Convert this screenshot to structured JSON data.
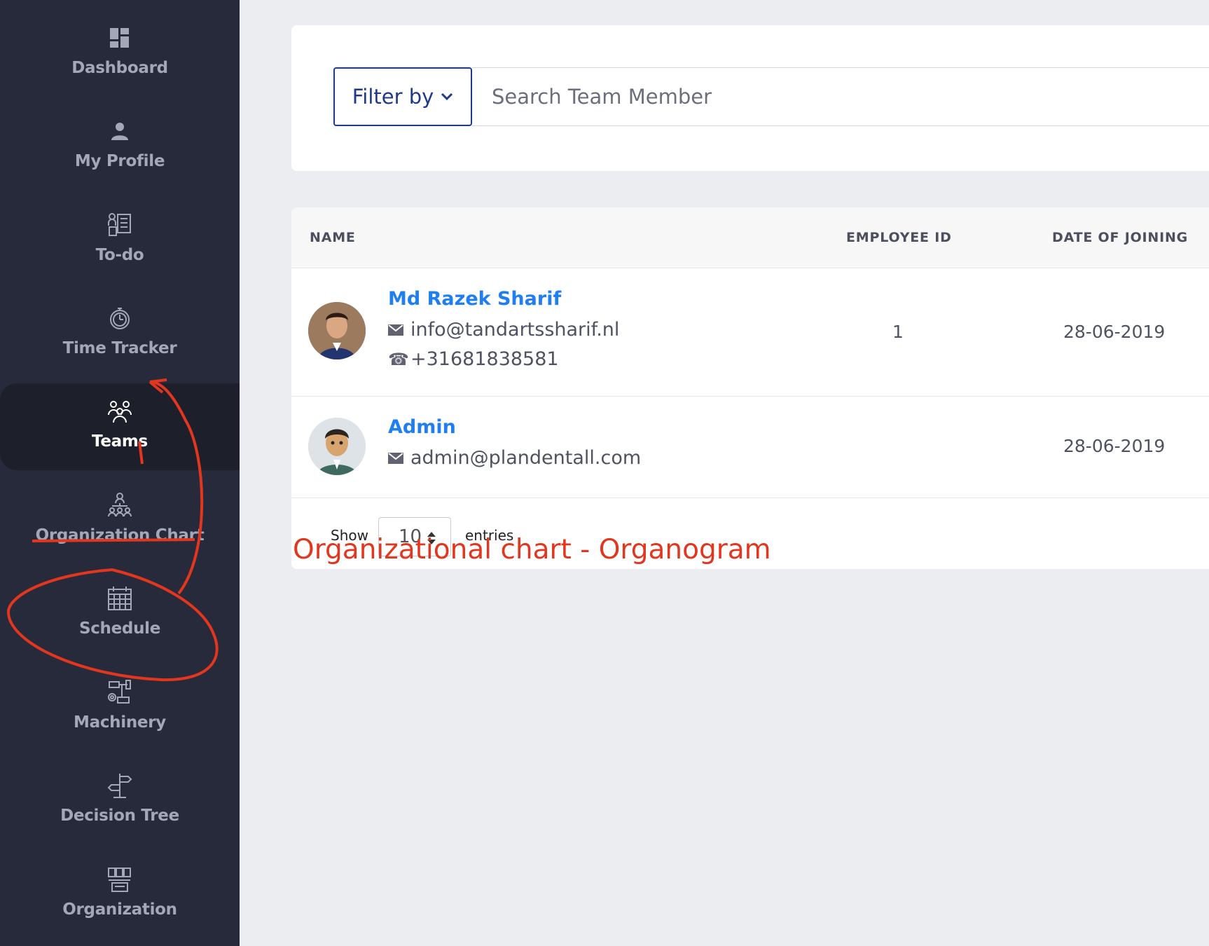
{
  "sidebar": {
    "items": [
      {
        "label": "Dashboard",
        "icon": "dashboard-icon"
      },
      {
        "label": "My Profile",
        "icon": "user-icon"
      },
      {
        "label": "To-do",
        "icon": "todo-icon"
      },
      {
        "label": "Time Tracker",
        "icon": "stopwatch-icon"
      },
      {
        "label": "Teams",
        "icon": "team-icon",
        "active": true
      },
      {
        "label": "Organization Chart",
        "icon": "org-chart-icon"
      },
      {
        "label": "Schedule",
        "icon": "calendar-icon"
      },
      {
        "label": "Machinery",
        "icon": "machinery-icon"
      },
      {
        "label": "Decision Tree",
        "icon": "signpost-icon"
      },
      {
        "label": "Organization",
        "icon": "organization-icon"
      }
    ]
  },
  "filter": {
    "button_label": "Filter by",
    "search_placeholder": "Search Team Member"
  },
  "table": {
    "headers": {
      "name": "NAME",
      "employee_id": "EMPLOYEE ID",
      "date_of_joining": "DATE OF JOINING"
    },
    "rows": [
      {
        "name": "Md Razek Sharif",
        "email": "info@tandartssharif.nl",
        "phone": "+31681838581",
        "employee_id": "1",
        "date_of_joining": "28-06-2019"
      },
      {
        "name": "Admin",
        "email": "admin@plandentall.com",
        "phone": "",
        "employee_id": "",
        "date_of_joining": "28-06-2019"
      }
    ],
    "show_label": "Show",
    "page_size": "10",
    "entries_label": "entries"
  },
  "annotation": {
    "text": "Organizational chart - Organogram",
    "color": "#e2361f"
  },
  "colors": {
    "sidebar_bg": "#272a3a",
    "link_blue": "#1f7ef0",
    "filter_border": "#1e3a8a"
  }
}
